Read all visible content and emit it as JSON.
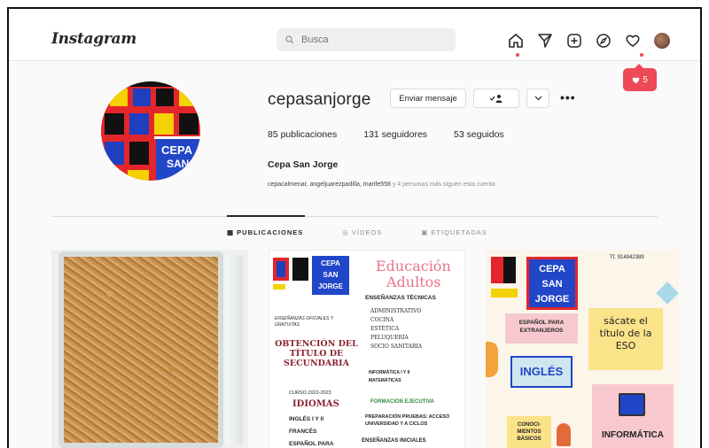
{
  "header": {
    "logo": "Instagram",
    "search_placeholder": "Busca",
    "notifications_count": "5",
    "icons": [
      "home-icon",
      "direct-icon",
      "new-post-icon",
      "explore-icon",
      "activity-heart-icon",
      "profile-avatar"
    ]
  },
  "profile": {
    "username": "cepasanjorge",
    "message_button": "Enviar mensaje",
    "posts": "85 publicaciones",
    "followers": "131 seguidores",
    "following": "53 seguidos",
    "full_name": "Cepa San Jorge",
    "followed_by_names": "cepacalmenar, angeljuarezpadilla, marife558",
    "followed_by_rest": " y 4 personas más siguen esta cuenta",
    "avatar_label_1": "CEPA",
    "avatar_label_2": "SAN"
  },
  "tabs": [
    "PUBLICACIONES",
    "VÍDEOS",
    "ETIQUETADAS"
  ],
  "post2": {
    "logo1": "CEPA",
    "logo2": "SAN",
    "logo3": "JORGE",
    "title1": "Educación",
    "title2": "Adultos",
    "tech_heading": "ENSEÑANZAS TÉCNICAS",
    "tech_items": [
      "ADMINISTRATIVO",
      "COCINA",
      "ESTÉTICA",
      "PELUQUERÍA",
      "SOCIO SANITARIA"
    ],
    "small_text": "ENSEÑANZAS OFICIALES Y GRATUITAS",
    "obtencion": "OBTENCIÓN DEL TÍTULO DE SECUNDARIA",
    "curso": "CURSO 2022-2023",
    "idiomas": "IDIOMAS",
    "lang_items": [
      "INGLÉS I Y II",
      "FRANCÉS",
      "ESPAÑOL PARA"
    ],
    "info_items": [
      "INFORMÁTICA I Y II",
      "MATEMÁTICAS"
    ],
    "formacion": "FORMACIÓN EJECUTIVA",
    "prep": "PREPARACIÓN PRUEBAS: ACCESO UNIVERSIDAD Y A CICLOS",
    "iniciales": "ENSEÑANZAS INICIALES"
  },
  "post3": {
    "phone": "Tf. 914942389",
    "logo1": "CEPA",
    "logo2": "SAN",
    "logo3": "JORGE",
    "espanol": "ESPAÑOL PARA EXTRANJEROS",
    "sacate": "sácate el título de la ESO",
    "ingles": "INGLÉS",
    "conoc": "CONOCI-MIENTOS BÁSICOS",
    "informatica": "INFORMÁTICA"
  }
}
